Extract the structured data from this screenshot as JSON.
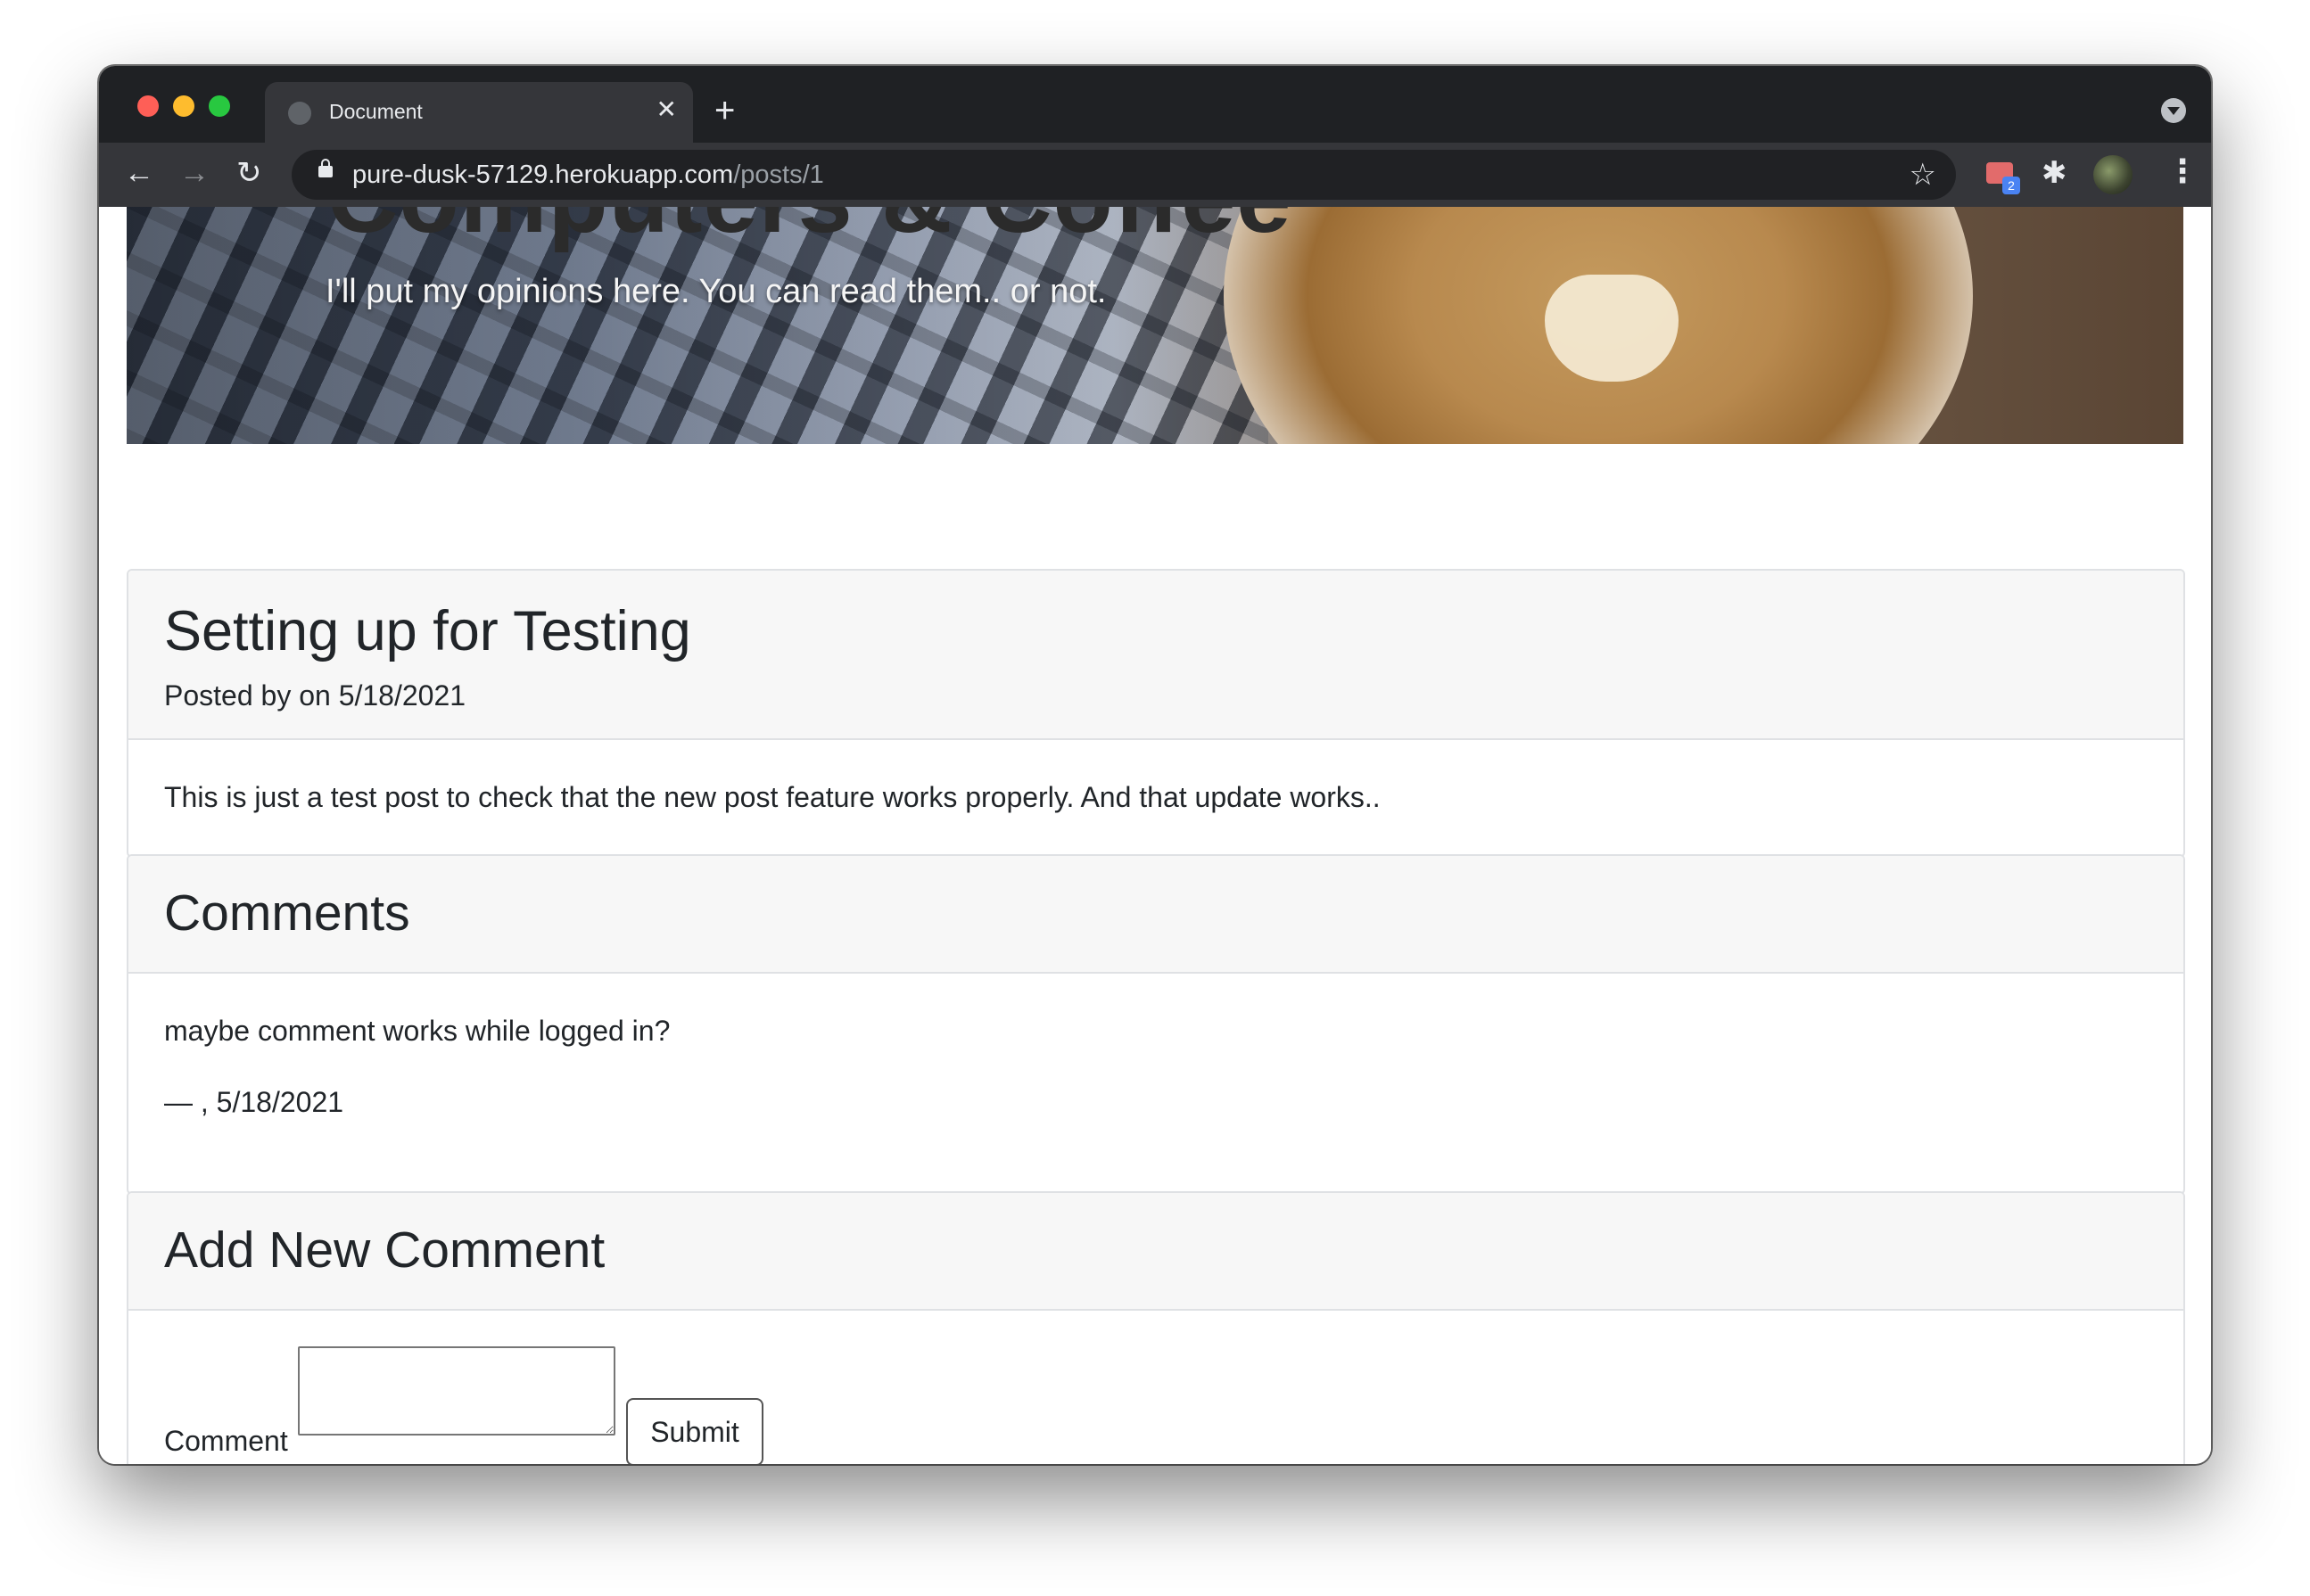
{
  "browser": {
    "tab_title": "Document",
    "close_glyph": "✕",
    "new_tab_glyph": "+",
    "url_domain": "pure-dusk-57129.herokuapp.com",
    "url_path": "/posts/1",
    "extension_badge": "2",
    "icons": [
      "back-icon",
      "forward-icon",
      "reload-icon",
      "lock-icon",
      "star-icon",
      "extension-icon",
      "puzzle-icon",
      "avatar",
      "more-icon"
    ]
  },
  "hero": {
    "title": "Computers & Coffee",
    "subtitle": "I'll put my opinions here. You can read them.. or not."
  },
  "post": {
    "title": "Setting up for Testing",
    "meta": "Posted by on 5/18/2021",
    "body": "This is just a test post to check that the new post feature works properly. And that update works.."
  },
  "comments": {
    "heading": "Comments",
    "items": [
      {
        "text": "maybe comment works while logged in?",
        "meta": "— , 5/18/2021"
      }
    ]
  },
  "new_comment": {
    "heading": "Add New Comment",
    "label": "Comment",
    "value": "",
    "submit_label": "Submit"
  },
  "colors": {
    "titlebar": "#1f2124",
    "toolbar": "#35363a",
    "card_header_bg": "#f7f7f7",
    "card_border": "#dfe1e4",
    "text": "#212529"
  }
}
